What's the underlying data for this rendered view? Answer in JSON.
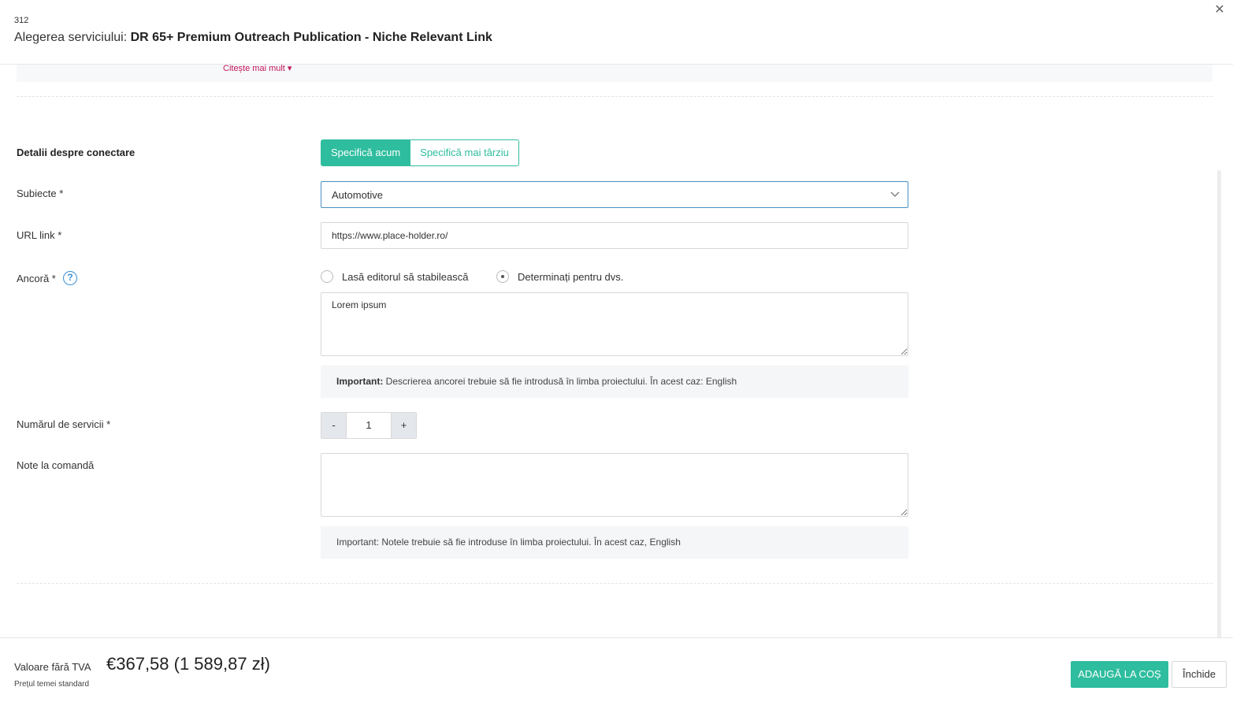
{
  "header": {
    "id": "312",
    "title_prefix": "Alegerea serviciului: ",
    "title_service": "DR 65+ Premium Outreach Publication - Niche Relevant Link",
    "close_glyph": "✕"
  },
  "top": {
    "read_more": "Citește mai mult ▾"
  },
  "form": {
    "connection": {
      "label": "Detalii despre conectare",
      "specify_now": "Specifică acum",
      "specify_later": "Specifică mai târziu"
    },
    "subjects": {
      "label": "Subiecte *",
      "value": "Automotive"
    },
    "url": {
      "label": "URL link *",
      "value": "https://www.place-holder.ro/"
    },
    "anchor": {
      "label": "Ancoră *",
      "help_glyph": "?",
      "option_editor": "Lasă editorul să stabilească",
      "option_self": "Determinați pentru dvs.",
      "selected": "self",
      "value": "Lorem ipsum",
      "note_bold": "Important:",
      "note_text": " Descrierea ancorei trebuie să fie introdusă în limba proiectului. În acest caz: English"
    },
    "quantity": {
      "label": "Numărul de servicii *",
      "minus": "-",
      "value": "1",
      "plus": "+"
    },
    "notes": {
      "label": "Note la comandă",
      "value": "",
      "note_text": "Important: Notele trebuie să fie introduse în limba proiectului. În acest caz, English"
    }
  },
  "footer": {
    "value_label": "Valoare fără TVA",
    "price": "€367,58 (1 589,87 zł)",
    "price_note": "Prețul temei standard",
    "add_to_cart": "ADAUGĂ LA COȘ",
    "close": "Închide"
  },
  "colors": {
    "accent": "#2ebd9e",
    "link": "#c2185b",
    "focus": "#4a90c2",
    "help": "#3b8fd6"
  },
  "icons": {
    "close": "close-icon",
    "chevron": "chevron-down-icon",
    "help": "help-icon"
  }
}
